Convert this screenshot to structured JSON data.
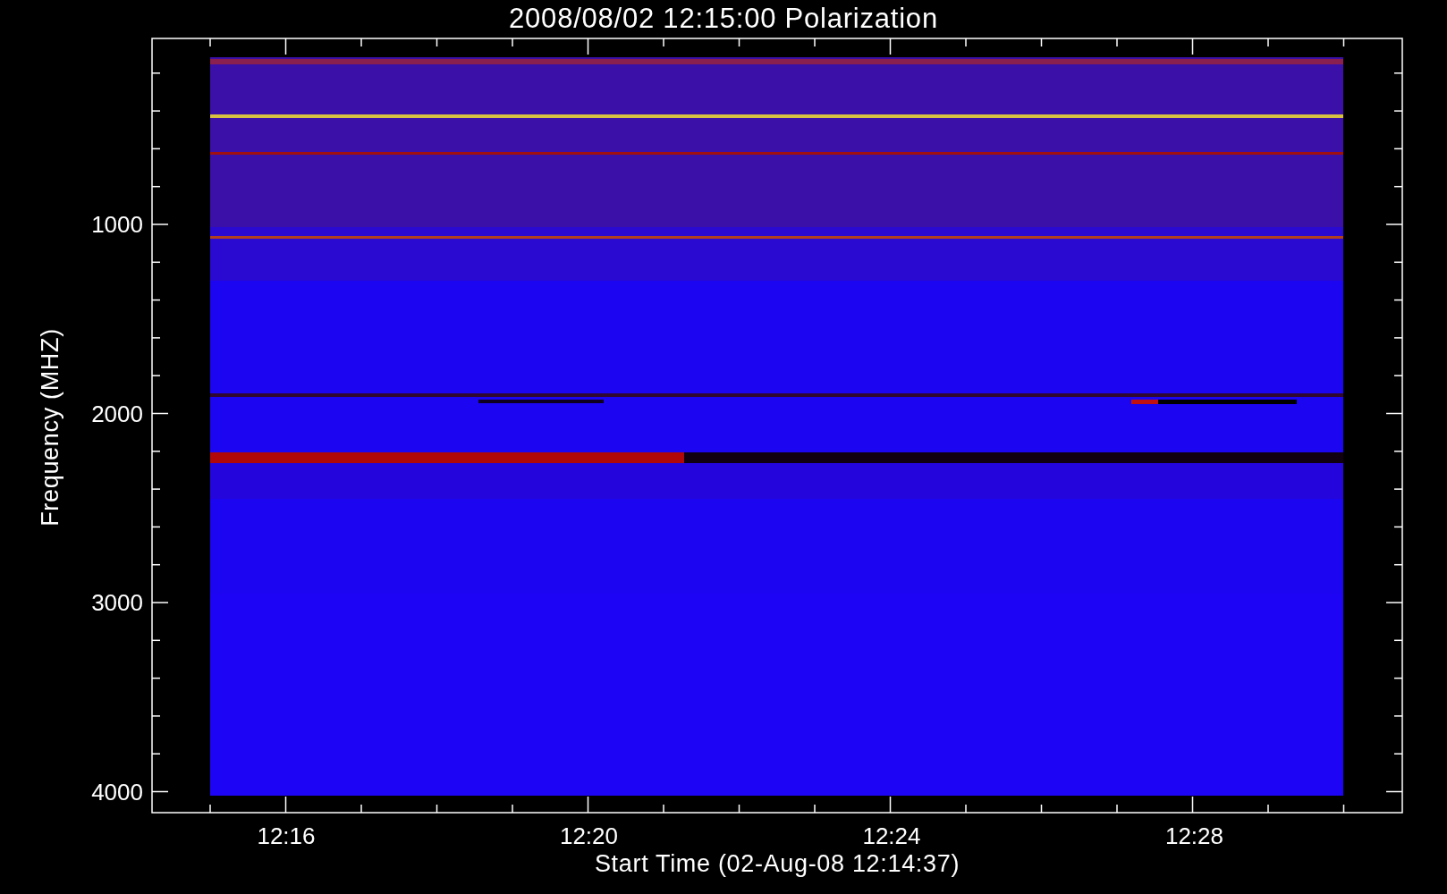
{
  "plot": {
    "title": "2008/08/02 12:15:00 Polarization",
    "ylabel": "Frequency (MHZ)",
    "xlabel": "Start Time (02-Aug-08 12:14:37)",
    "yticks": [
      "1000",
      "2000",
      "3000",
      "4000"
    ],
    "xticks": [
      "12:16",
      "12:20",
      "12:24",
      "12:28"
    ]
  }
}
